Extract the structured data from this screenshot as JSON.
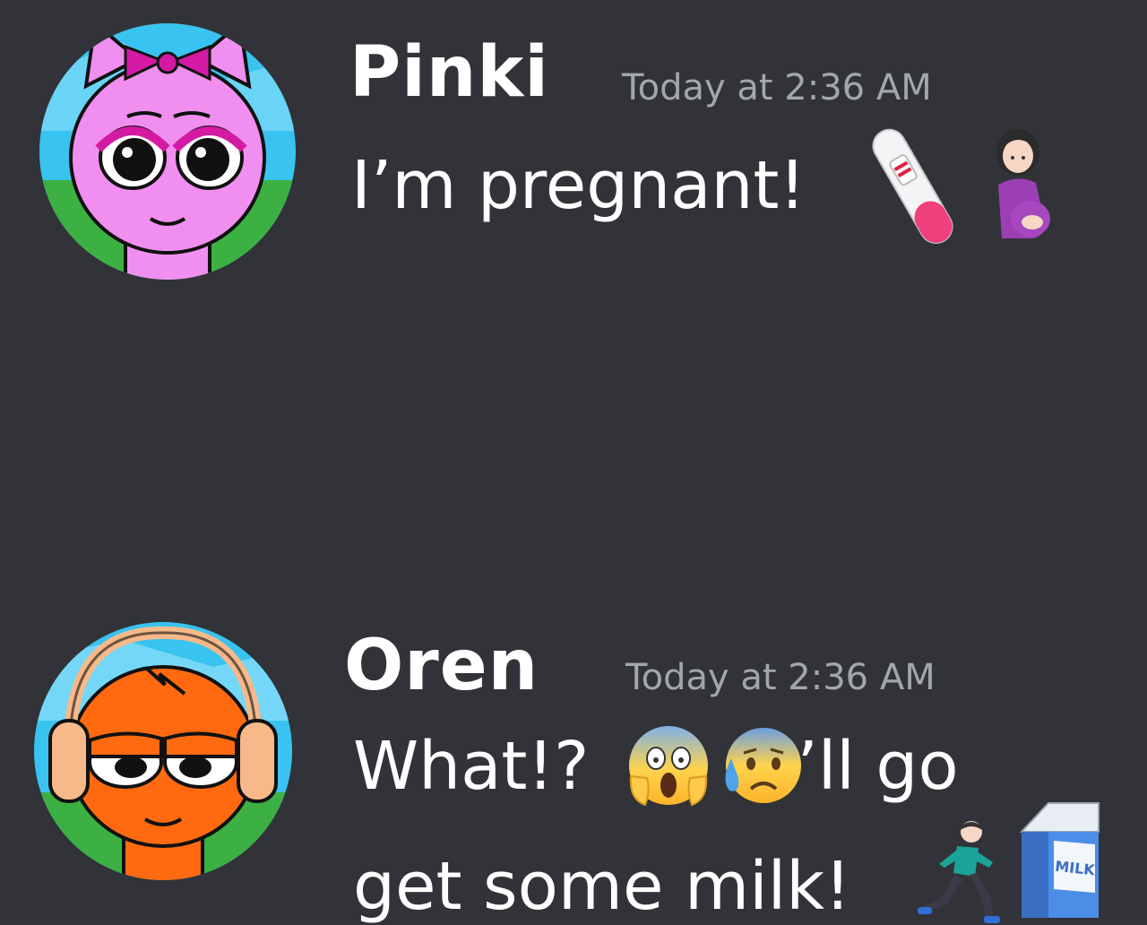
{
  "messages": [
    {
      "username": "Pinki",
      "timestamp": "Today at 2:36 AM",
      "text": "I’m pregnant!",
      "emojis": [
        "pregnancy-test-icon",
        "pregnant-woman-icon"
      ],
      "avatar": "pinki-avatar"
    },
    {
      "username": "Oren",
      "timestamp": "Today at 2:36 AM",
      "text_line_1": "What!?",
      "text_line_1b": "I’ll go",
      "text_line_2": "get some milk!",
      "emojis": [
        "screaming-face-icon",
        "anxious-sweat-face-icon",
        "running-man-icon",
        "milk-carton-icon"
      ],
      "avatar": "oren-avatar"
    }
  ],
  "emoji_labels": {
    "milk": "MILK"
  },
  "colors": {
    "background": "#313338",
    "username": "#ffffff",
    "timestamp": "#a3a6ad",
    "text": "#ffffff",
    "pinki": "#f08ff0",
    "oren": "#ff6a10"
  }
}
